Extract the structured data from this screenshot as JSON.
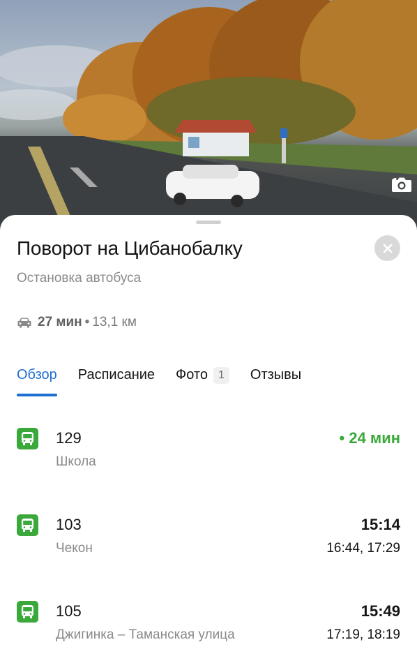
{
  "photo": {
    "count": "1",
    "icon": "camera-icon"
  },
  "place": {
    "title": "Поворот на Цибанобалку",
    "category": "Остановка автобуса",
    "close_icon": "close-icon"
  },
  "route": {
    "icon": "car-icon",
    "duration": "27 мин",
    "separator": "•",
    "distance": "13,1 км"
  },
  "tabs": [
    {
      "label": "Обзор",
      "active": true
    },
    {
      "label": "Расписание"
    },
    {
      "label": "Фото",
      "badge": "1"
    },
    {
      "label": "Отзывы"
    }
  ],
  "transit": [
    {
      "number": "129",
      "destination": "Школа",
      "arrival": "• 24 мин",
      "next": "",
      "live": true
    },
    {
      "number": "103",
      "destination": "Чекон",
      "arrival": "15:14",
      "next": "16:44, 17:29",
      "live": false
    },
    {
      "number": "105",
      "destination": "Джигинка – Таманская улица",
      "arrival": "15:49",
      "next": "17:19, 18:19",
      "live": false
    }
  ],
  "colors": {
    "accent": "#1e6fd1",
    "bus_green": "#3aa83a",
    "muted_text": "#8a8a8a"
  }
}
